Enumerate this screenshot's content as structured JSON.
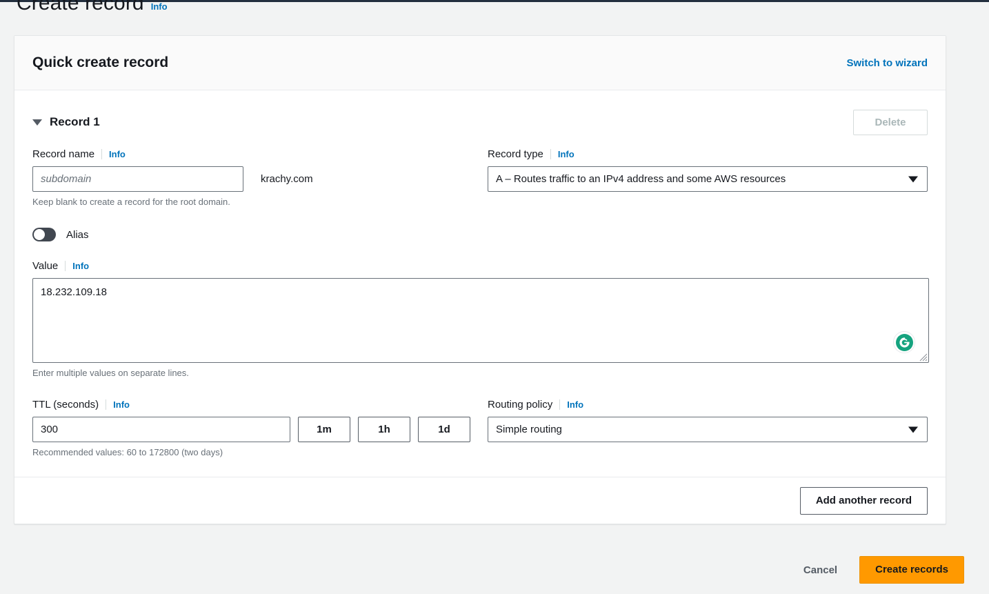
{
  "page": {
    "title": "Create record",
    "info_label": "Info"
  },
  "card": {
    "title": "Quick create record",
    "switch_link": "Switch to wizard"
  },
  "record": {
    "header_label": "Record 1",
    "delete_label": "Delete",
    "delete_disabled": true,
    "name_field": {
      "label": "Record name",
      "info_label": "Info",
      "placeholder": "subdomain",
      "value": "",
      "suffix": "krachy.com",
      "hint": "Keep blank to create a record for the root domain."
    },
    "type_field": {
      "label": "Record type",
      "info_label": "Info",
      "selected": "A – Routes traffic to an IPv4 address and some AWS resources"
    },
    "alias": {
      "label": "Alias",
      "enabled": false
    },
    "value_field": {
      "label": "Value",
      "info_label": "Info",
      "value": "18.232.109.18",
      "hint": "Enter multiple values on separate lines.",
      "assistant_icon": "grammarly-icon",
      "assistant_glyph": "G"
    },
    "ttl_field": {
      "label": "TTL (seconds)",
      "info_label": "Info",
      "value": "300",
      "hint": "Recommended values: 60 to 172800 (two days)",
      "presets": [
        "1m",
        "1h",
        "1d"
      ]
    },
    "routing_field": {
      "label": "Routing policy",
      "info_label": "Info",
      "selected": "Simple routing"
    }
  },
  "footer": {
    "add_another_label": "Add another record",
    "cancel_label": "Cancel",
    "create_label": "Create records"
  },
  "colors": {
    "page_background": "#f2f3f3",
    "link_blue": "#0073bb",
    "primary_orange": "#ff9900",
    "text_dark": "#16191f",
    "muted_text": "#687078",
    "navbar": "#232f3e",
    "grammarly_teal": "#15a37f"
  }
}
